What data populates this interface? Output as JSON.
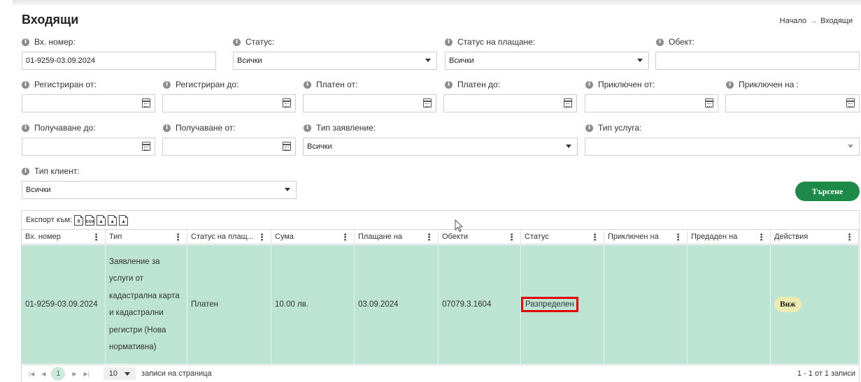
{
  "page": {
    "title": "Входящи"
  },
  "breadcrumb": {
    "home": "Начало",
    "separator": "→",
    "current": "Входящи"
  },
  "filters": {
    "incoming_number": {
      "label": "Вх. номер:",
      "value": "01-9259-03.09.2024"
    },
    "status": {
      "label": "Статус:",
      "value": "Всички"
    },
    "payment_status": {
      "label": "Статус на плащане:",
      "value": "Всички"
    },
    "object": {
      "label": "Обект:",
      "value": ""
    },
    "registered_from": {
      "label": "Регистриран от:"
    },
    "registered_to": {
      "label": "Регистриран до:"
    },
    "paid_from": {
      "label": "Платен от:"
    },
    "paid_to": {
      "label": "Платен до:"
    },
    "closed_from": {
      "label": "Приключен от:"
    },
    "closed_on": {
      "label": "Приключен на :"
    },
    "received_to": {
      "label": "Получаване до:"
    },
    "received_from": {
      "label": "Получаване от:"
    },
    "application_type": {
      "label": "Тип заявление:",
      "value": "Всички"
    },
    "service_type": {
      "label": "Тип услуга:",
      "value": ""
    },
    "client_type": {
      "label": "Тип клиент:",
      "value": "Всички"
    }
  },
  "search_button": "Търсене",
  "grid": {
    "export_label": "Експорт към:",
    "export_icons": [
      "excel-icon",
      "csv-icon",
      "pdf-icon",
      "pdf-icon",
      "pdf-icon"
    ],
    "columns": [
      "Вх. номер",
      "Тип",
      "Статус на плащ...",
      "Сума",
      "Плащане на",
      "Обекти",
      "Статус",
      "Приключен на",
      "Предаден на",
      "Действия"
    ],
    "rows": [
      {
        "number": "01-9259-03.09.2024",
        "type": [
          "Заявление за",
          "услуги от",
          "кадастрална карта",
          "и кадастрални",
          "регистри (Нова",
          "нормативна)"
        ],
        "payment_status": "Платен",
        "amount": "10.00 лв.",
        "paid_on": "03.09.2024",
        "objects": "07079.3.1604",
        "status": "Разпределен",
        "closed_on": "",
        "handed_on": "",
        "action": "Виж"
      }
    ],
    "pager": {
      "page": "1",
      "page_size": "10",
      "page_size_label": "записи на страница",
      "info": "1 - 1 от 1 записи"
    }
  },
  "colors": {
    "accent": "#1e8a4a",
    "row_highlight": "#bde3d3",
    "status_highlight": "#e00000",
    "view_button": "#ecebb0"
  }
}
